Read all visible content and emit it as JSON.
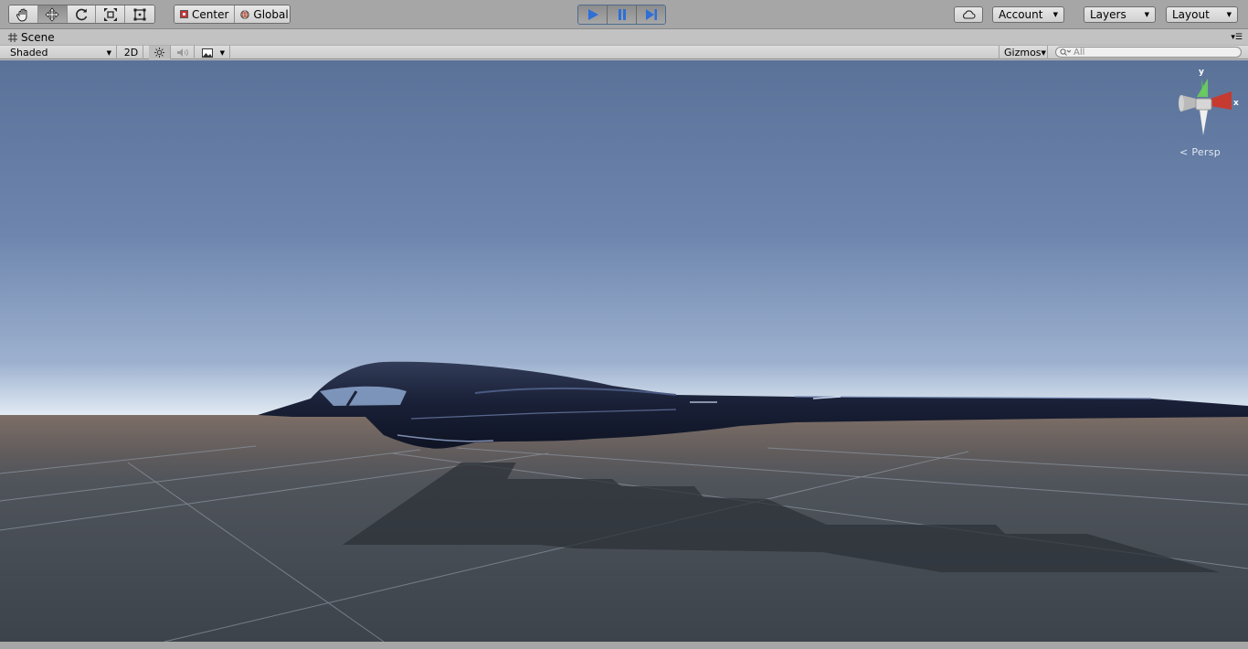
{
  "toolbar": {
    "tools": [
      {
        "icon": "hand-icon",
        "label": "Hand tool"
      },
      {
        "icon": "move-icon",
        "label": "Move tool"
      },
      {
        "icon": "rotate-icon",
        "label": "Rotate tool"
      },
      {
        "icon": "scale-icon",
        "label": "Scale tool"
      },
      {
        "icon": "rect-icon",
        "label": "Rect tool"
      }
    ],
    "pivot_center_label": "Center",
    "pivot_global_label": "Global",
    "account_label": "Account",
    "layers_label": "Layers",
    "layout_label": "Layout"
  },
  "scene": {
    "tab_label": "Scene",
    "shading_mode": "Shaded",
    "mode_2d_label": "2D",
    "gizmos_label": "Gizmos",
    "search_placeholder": "All",
    "projection_label": "Persp",
    "gizmo_y_label": "y",
    "gizmo_x_label": "x"
  },
  "colors": {
    "play_accent": "#2e6fd8",
    "sky_top": "#5a7298",
    "horizon": "#eef3f7",
    "ground": "#3f464e",
    "aircraft": "#1b2238"
  }
}
